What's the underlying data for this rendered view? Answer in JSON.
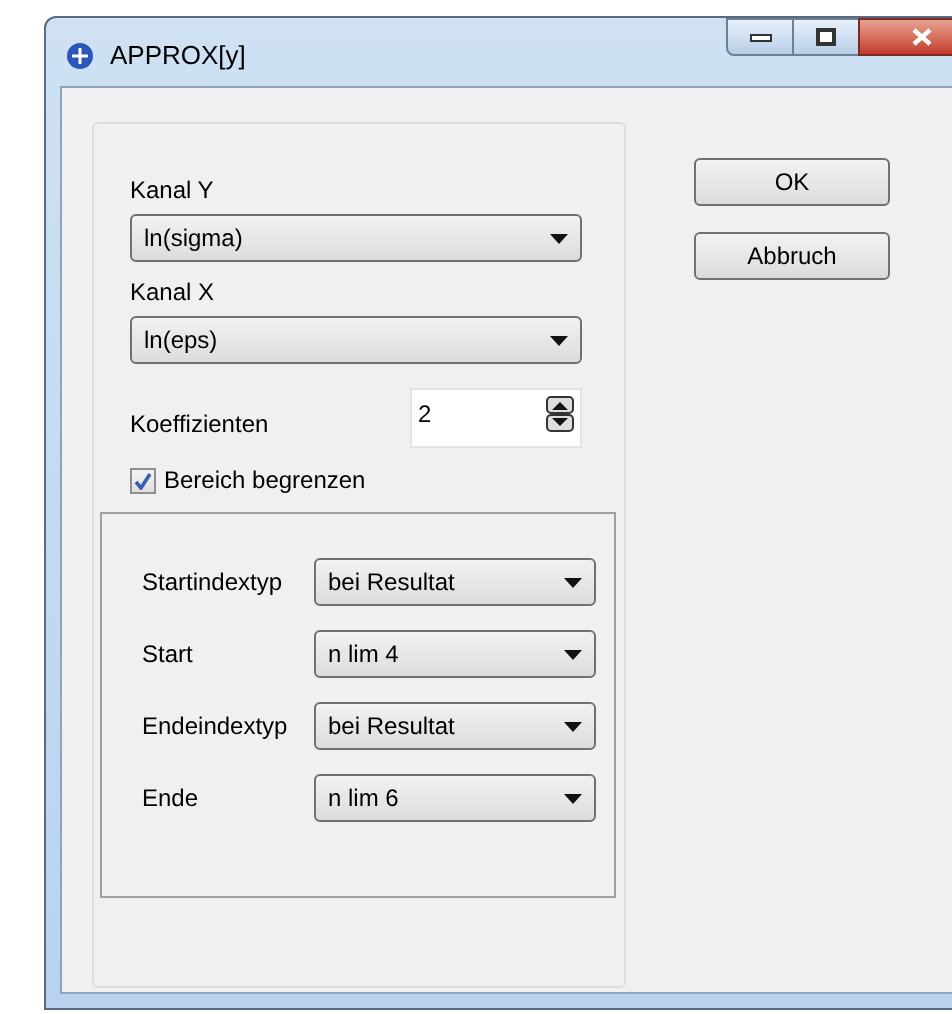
{
  "window": {
    "title": "APPROX[y]"
  },
  "fields": [
    {
      "kind": "select",
      "label": "Kanal Y",
      "value": "ln(sigma)"
    },
    {
      "kind": "select",
      "label": "Kanal X",
      "value": "ln(eps)"
    }
  ],
  "coefficients": {
    "label": "Koeffizienten",
    "value": "2"
  },
  "limit_range": {
    "label": "Bereich begrenzen",
    "checked": true
  },
  "range": [
    {
      "label": "Startindextyp",
      "value": "bei Resultat"
    },
    {
      "label": "Start",
      "value": "n lim 4"
    },
    {
      "label": "Endeindextyp",
      "value": "bei Resultat"
    },
    {
      "label": "Ende",
      "value": "n lim 6"
    }
  ],
  "buttons": [
    "OK",
    "Abbruch"
  ]
}
